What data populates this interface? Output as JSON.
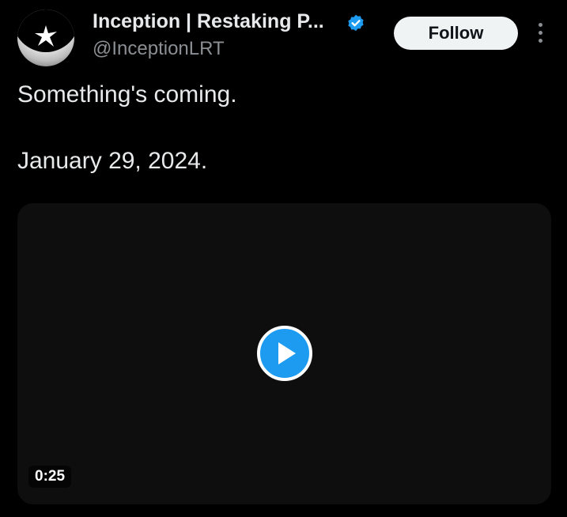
{
  "author": {
    "display_name": "Inception | Restaking P...",
    "handle": "@InceptionLRT",
    "verified": true,
    "avatar_icon": "inception-logo-icon"
  },
  "actions": {
    "follow_label": "Follow",
    "more_icon": "more-vertical-icon"
  },
  "tweet": {
    "text_line1": "Something's coming.",
    "text_line2": "January 29, 2024."
  },
  "media": {
    "type": "video",
    "duration": "0:25",
    "play_icon": "play-icon"
  },
  "colors": {
    "background": "#000000",
    "text_primary": "#e7e9ea",
    "text_secondary": "#8b8f93",
    "accent": "#1d9bf0",
    "follow_bg": "#eff3f4"
  }
}
